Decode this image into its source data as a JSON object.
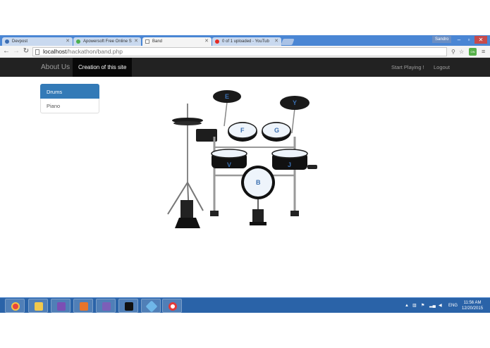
{
  "browser": {
    "tabs": [
      {
        "label": "Devpost",
        "active": false,
        "icon_color": "#3b6db3"
      },
      {
        "label": "Apowersoft Free Online S",
        "active": false,
        "icon_color": "#4caf50"
      },
      {
        "label": "Band",
        "active": true,
        "icon_color": "#888888"
      },
      {
        "label": "0 of 1 uploaded - YouTub",
        "active": false,
        "icon_color": "#e52d27"
      }
    ],
    "profile": "Sandro",
    "url_host": "localhost",
    "url_path": "/hackathon/band.php",
    "ext_label": "ON"
  },
  "navbar": {
    "brand": "About Us",
    "active_item": "Creation of this site",
    "right_items": [
      "Start Playing !",
      "Logout"
    ]
  },
  "sidebar": {
    "items": [
      {
        "label": "Drums",
        "active": true
      },
      {
        "label": "Piano",
        "active": false
      }
    ]
  },
  "drum_kit": {
    "pad_letters": [
      "E",
      "Y",
      "F",
      "G",
      "V",
      "J",
      "B"
    ]
  },
  "taskbar": {
    "apps": [
      "chrome-icon",
      "file-explorer-icon",
      "visual-studio-icon",
      "xampp-icon",
      "php-storm-icon",
      "command-prompt-icon",
      "picasa-icon",
      "recorder-icon"
    ],
    "tray_lang": "ENG",
    "time": "11:56 AM",
    "date": "12/20/2015"
  },
  "colors": {
    "navbar_bg": "#222222",
    "active_blue": "#337ab7",
    "taskbar_bg": "#2a63a8"
  }
}
